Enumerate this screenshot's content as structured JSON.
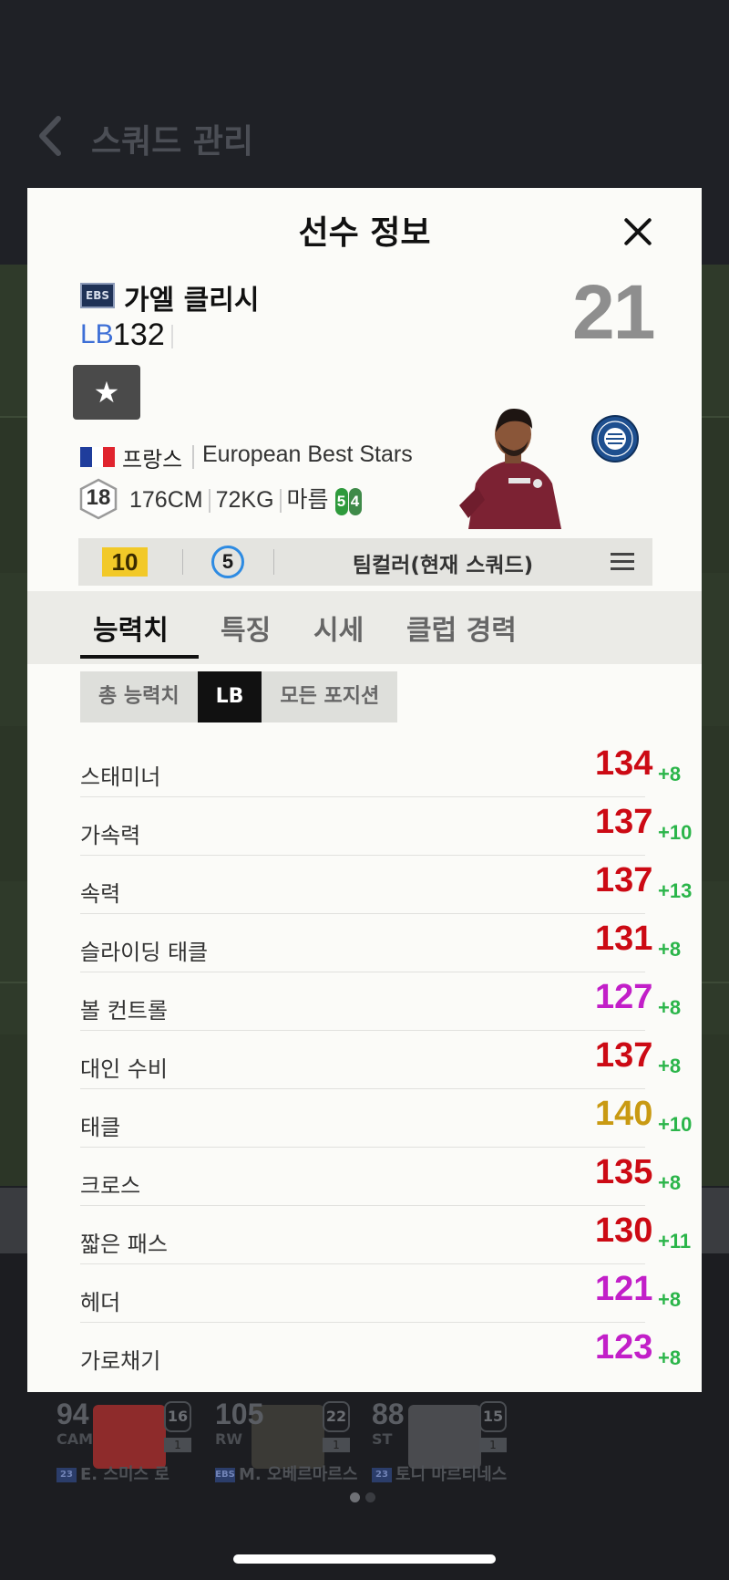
{
  "background": {
    "page_title": "스쿼드 관리",
    "squad_players": [
      {
        "ovr": "94",
        "pos": "CAM",
        "level": "16",
        "count": "1",
        "season": "23",
        "name": "E. 스미스 로"
      },
      {
        "ovr": "105",
        "pos": "RW",
        "level": "22",
        "count": "1",
        "season": "EBS",
        "name": "M. 오베르마르스"
      },
      {
        "ovr": "88",
        "pos": "ST",
        "level": "15",
        "count": "1",
        "season": "23",
        "name": "토니 마르티네스"
      }
    ]
  },
  "modal": {
    "title": "선수 정보",
    "close_icon": "close-icon",
    "player": {
      "season_badge": "EBS",
      "name": "가엘 클리시",
      "position": "LB",
      "overall": "132",
      "number": "21",
      "favorite_icon": "★",
      "nation": "프랑스",
      "league": "European Best Stars",
      "age": "18",
      "height": "176CM",
      "weight": "72KG",
      "body_type": "마름",
      "left_foot": "5",
      "right_foot": "4"
    },
    "info_bar": {
      "enhance_grade": "10",
      "salary_grade": "5",
      "team_color": "팀컬러(현재 스쿼드)"
    },
    "tabs": [
      "능력치",
      "특징",
      "시세",
      "클럽 경력"
    ],
    "active_tab": 0,
    "subtabs": [
      "총 능력치",
      "LB",
      "모든 포지션"
    ],
    "active_subtab": 1,
    "stats": [
      {
        "name": "스태미너",
        "value": "134",
        "bonus": "+8",
        "color": "#cc0a14"
      },
      {
        "name": "가속력",
        "value": "137",
        "bonus": "+10",
        "color": "#cc0a14"
      },
      {
        "name": "속력",
        "value": "137",
        "bonus": "+13",
        "color": "#cc0a14"
      },
      {
        "name": "슬라이딩 태클",
        "value": "131",
        "bonus": "+8",
        "color": "#cc0a14"
      },
      {
        "name": "볼 컨트롤",
        "value": "127",
        "bonus": "+8",
        "color": "#c21fc8"
      },
      {
        "name": "대인 수비",
        "value": "137",
        "bonus": "+8",
        "color": "#cc0a14"
      },
      {
        "name": "태클",
        "value": "140",
        "bonus": "+10",
        "color": "#c99a12"
      },
      {
        "name": "크로스",
        "value": "135",
        "bonus": "+8",
        "color": "#cc0a14"
      },
      {
        "name": "짧은 패스",
        "value": "130",
        "bonus": "+11",
        "color": "#cc0a14"
      },
      {
        "name": "헤더",
        "value": "121",
        "bonus": "+8",
        "color": "#c21fc8"
      },
      {
        "name": "가로채기",
        "value": "123",
        "bonus": "+8",
        "color": "#c21fc8"
      }
    ]
  }
}
